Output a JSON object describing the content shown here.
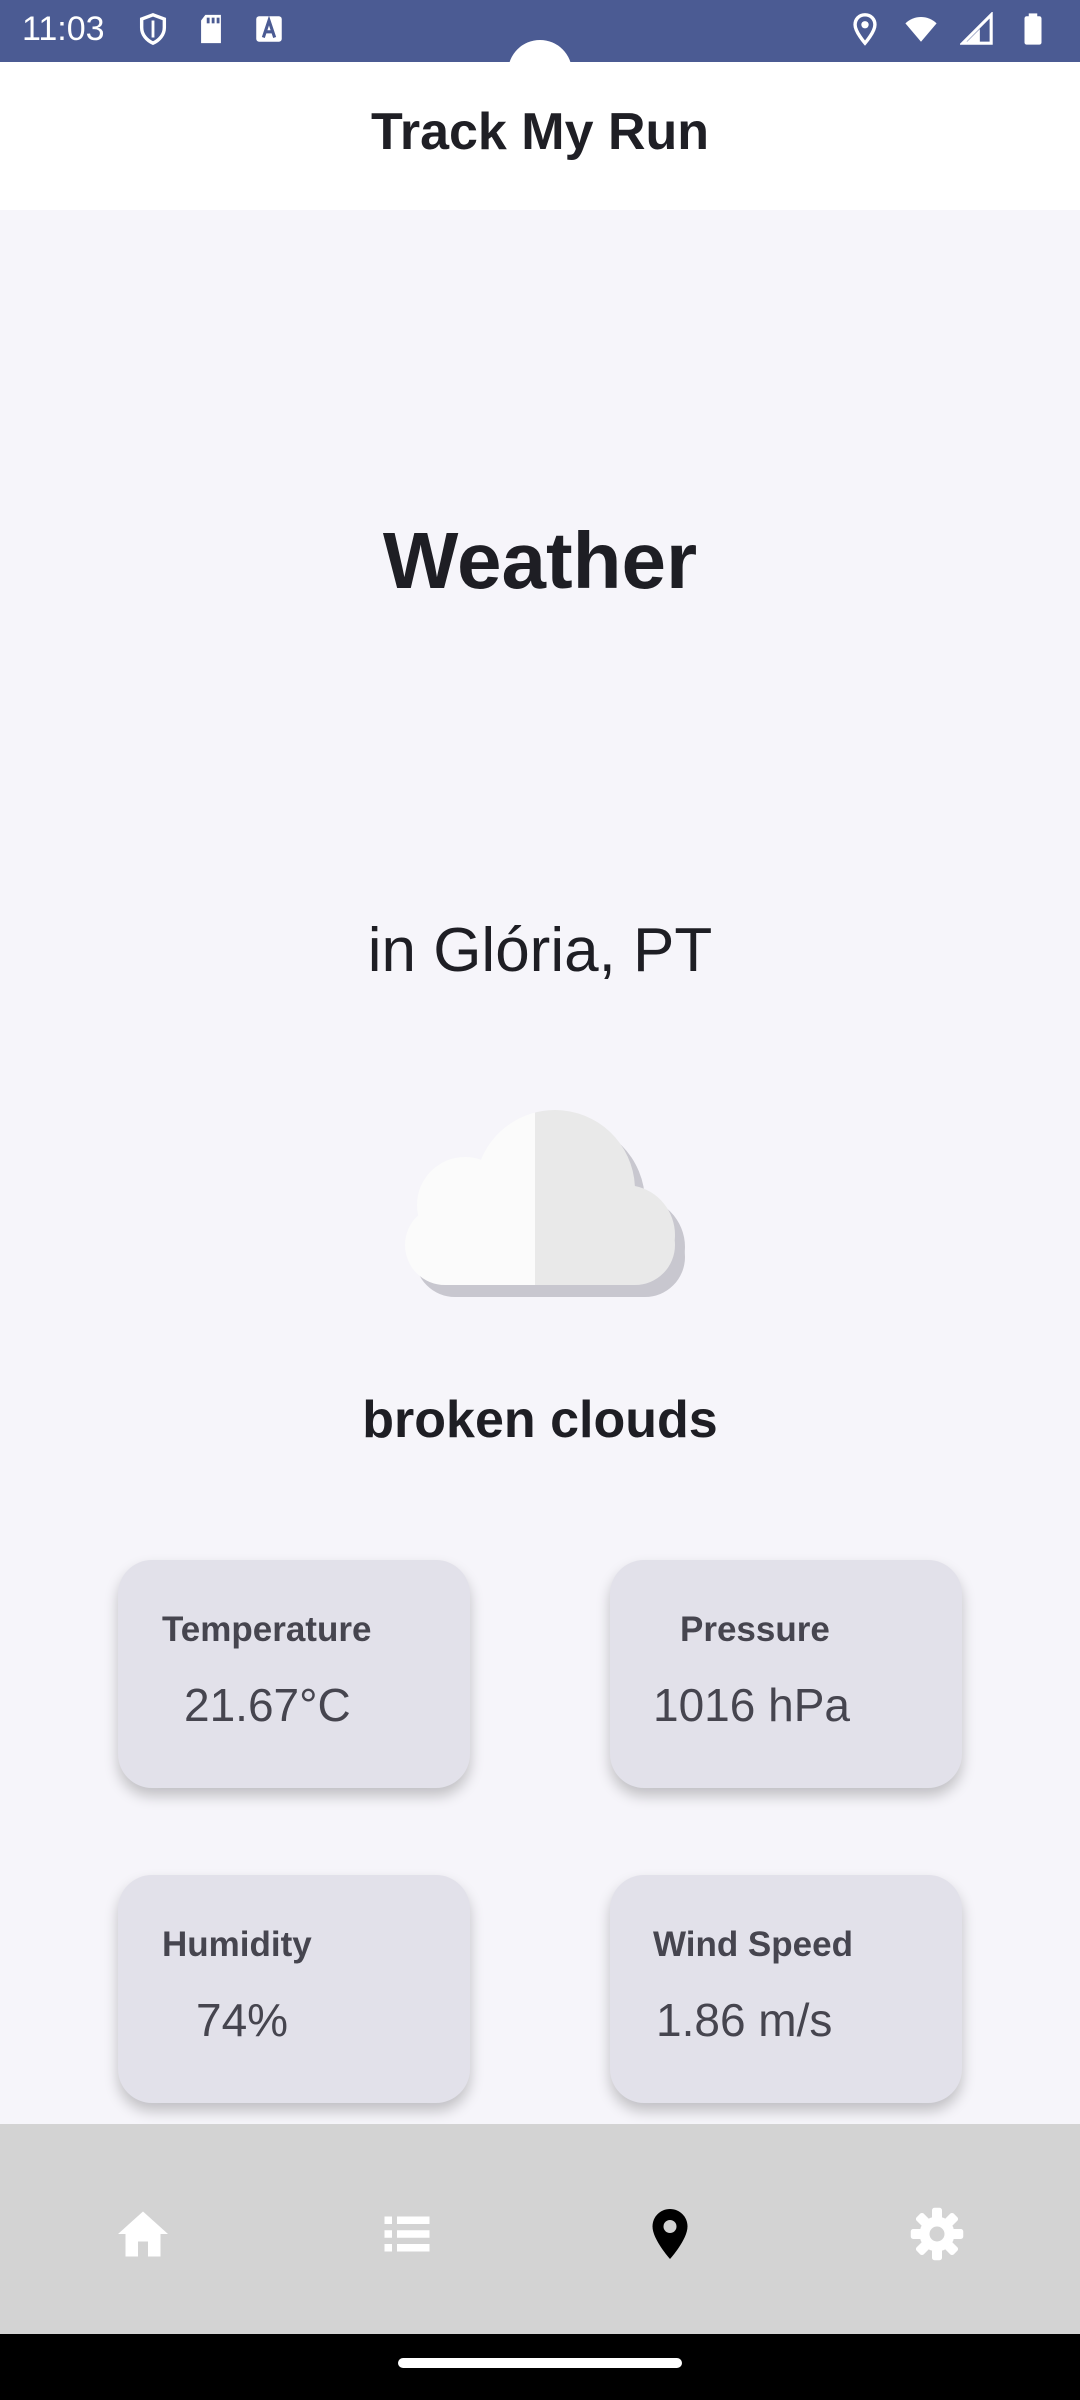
{
  "status_bar": {
    "time": "11:03",
    "left_icons": [
      "shield-icon",
      "sd-card-icon",
      "font-icon"
    ],
    "right_icons": [
      "location-icon",
      "wifi-icon",
      "signal-icon",
      "battery-icon"
    ],
    "color": "#4b5b93"
  },
  "app_bar": {
    "title": "Track My Run"
  },
  "weather": {
    "heading": "Weather",
    "location": "in Glória, PT",
    "icon": "cloud-icon",
    "description": "broken clouds"
  },
  "cards": [
    {
      "label": "Temperature",
      "value": "21.67°C"
    },
    {
      "label": "Pressure",
      "value": "1016 hPa"
    },
    {
      "label": "Humidity",
      "value": "74%"
    },
    {
      "label": "Wind Speed",
      "value": "1.86 m/s"
    }
  ],
  "bottom_nav": {
    "items": [
      {
        "icon": "home-icon",
        "selected": false
      },
      {
        "icon": "list-icon",
        "selected": false
      },
      {
        "icon": "location-pin-icon",
        "selected": true
      },
      {
        "icon": "settings-icon",
        "selected": false
      }
    ]
  }
}
